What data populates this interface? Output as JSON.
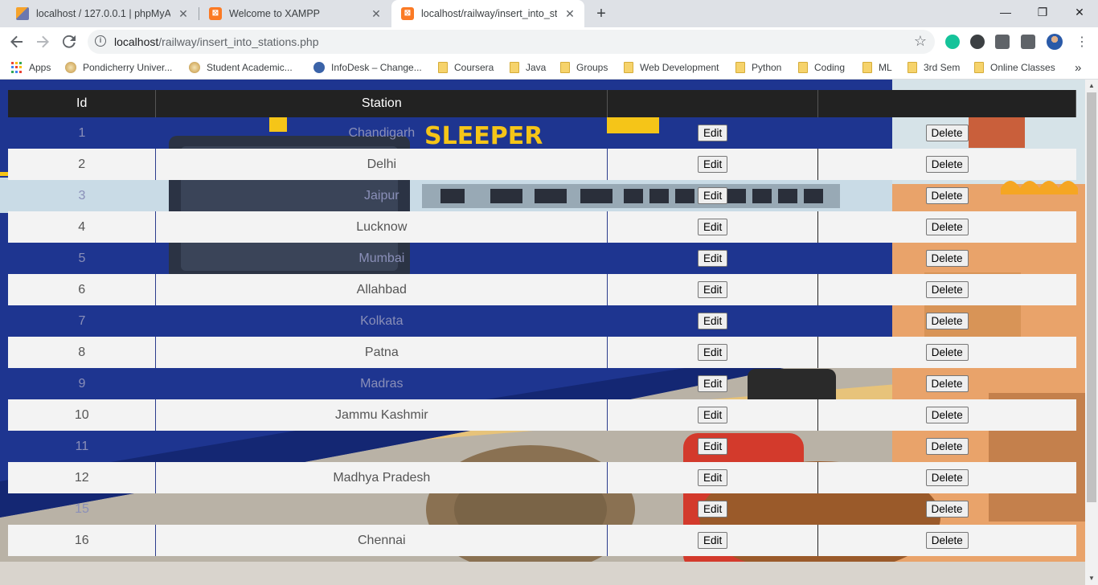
{
  "browser": {
    "tabs": [
      {
        "title": "localhost / 127.0.0.1 | phpMyAdmin",
        "favicon": "phpmyadmin-icon",
        "active": false
      },
      {
        "title": "Welcome to XAMPP",
        "favicon": "xampp-icon",
        "active": false
      },
      {
        "title": "localhost/railway/insert_into_stations.php",
        "favicon": "xampp-icon",
        "active": true
      }
    ],
    "new_tab_symbol": "+",
    "window_controls": {
      "minimize": "—",
      "maximize": "❐",
      "close": "✕"
    },
    "address": {
      "host": "localhost",
      "path": "/railway/insert_into_stations.php"
    },
    "bookmarks": [
      {
        "label": "Apps",
        "icon": "apps-icon"
      },
      {
        "label": "Pondicherry Univer...",
        "icon": "university-seal-icon"
      },
      {
        "label": "Student Academic...",
        "icon": "university-seal-icon"
      },
      {
        "label": "InfoDesk – Change...",
        "icon": "infodesk-icon"
      },
      {
        "label": "Coursera",
        "icon": "folder-icon"
      },
      {
        "label": "Java",
        "icon": "folder-icon"
      },
      {
        "label": "Groups",
        "icon": "folder-icon"
      },
      {
        "label": "Web Development",
        "icon": "folder-icon"
      },
      {
        "label": "Python",
        "icon": "folder-icon"
      },
      {
        "label": "Coding",
        "icon": "folder-icon"
      },
      {
        "label": "ML",
        "icon": "folder-icon"
      },
      {
        "label": "3rd Sem",
        "icon": "folder-icon"
      },
      {
        "label": "Online Classes",
        "icon": "folder-icon"
      }
    ],
    "overflow_symbol": "»"
  },
  "table": {
    "headers": [
      "Id",
      "Station",
      "",
      ""
    ],
    "edit_label": "Edit",
    "delete_label": "Delete",
    "rows": [
      {
        "id": "1",
        "station": "Chandigarh"
      },
      {
        "id": "2",
        "station": "Delhi"
      },
      {
        "id": "3",
        "station": "Jaipur"
      },
      {
        "id": "4",
        "station": "Lucknow"
      },
      {
        "id": "5",
        "station": "Mumbai"
      },
      {
        "id": "6",
        "station": "Allahbad"
      },
      {
        "id": "7",
        "station": "Kolkata"
      },
      {
        "id": "8",
        "station": "Patna"
      },
      {
        "id": "9",
        "station": "Madras"
      },
      {
        "id": "10",
        "station": "Jammu Kashmir"
      },
      {
        "id": "11",
        "station": ""
      },
      {
        "id": "12",
        "station": "Madhya Pradesh"
      },
      {
        "id": "15",
        "station": ""
      },
      {
        "id": "16",
        "station": "Chennai"
      }
    ]
  },
  "background_text": "SLEEPER",
  "colors": {
    "train_blue": "#1e3590",
    "header_bg": "#222222",
    "even_row_bg": "#f3f3f3",
    "accent_yellow": "#f5c518"
  }
}
